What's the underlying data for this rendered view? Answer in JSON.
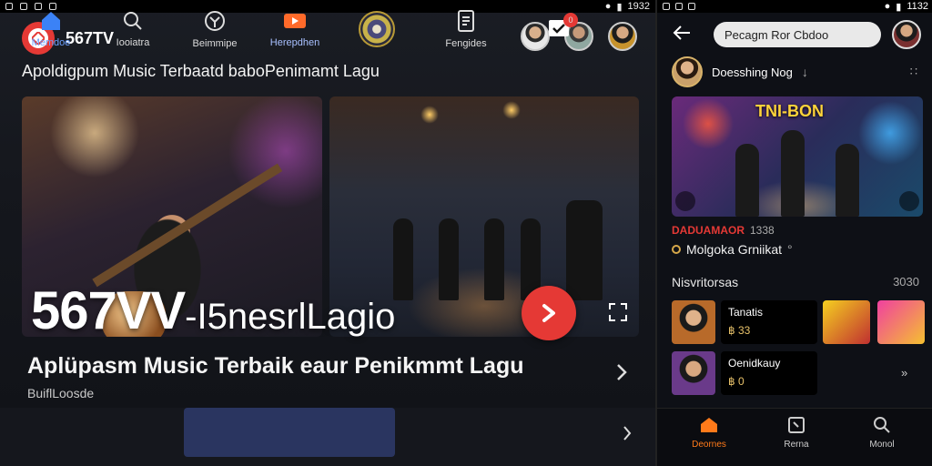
{
  "status_left": {
    "time": "1932"
  },
  "status_right": {
    "time": "1132"
  },
  "app": {
    "name": "567TV"
  },
  "left": {
    "subtitle": "Apoldigpum Music Terbaatd baboPenimamt Lagu",
    "overlay_title": "567VV",
    "overlay_suffix": "-I5nesrlLagio",
    "song_title": "Aplüpasm Music Terbaik eaur Penikmmt Lagu",
    "song_artist": "BuiflLoosde",
    "nav": [
      {
        "label": "Memdoe",
        "icon": "home-icon"
      },
      {
        "label": "Iooiatra",
        "icon": "search-icon"
      },
      {
        "label": "Beimmipe",
        "icon": "discover-icon"
      },
      {
        "label": "Herepdhen",
        "icon": "video-icon"
      },
      {
        "label": "",
        "icon": "disc-icon"
      },
      {
        "label": "Fengides",
        "icon": "document-icon"
      },
      {
        "label": "",
        "icon": "inbox-icon",
        "badge": "0"
      }
    ]
  },
  "right": {
    "search_value": "Pecagm Ror Cbdoo",
    "profile_name": "Doesshing Nog",
    "feature_title": "TNI-BON",
    "meta_tag": "DADUAMAOR",
    "meta_num": "1338",
    "meta_name": "Molgoka Grniikat",
    "meta_suffix": "°",
    "section_title": "Nisvritorsas",
    "section_count": "3030",
    "recs": [
      {
        "title": "Tanatis",
        "sub": "฿ 33"
      },
      {
        "title": "Oenidkauy",
        "sub": "฿ 0"
      }
    ],
    "nav": [
      {
        "label": "Deornes",
        "icon": "home-icon",
        "active": true
      },
      {
        "label": "Rerna",
        "icon": "clock-icon"
      },
      {
        "label": "Monol",
        "icon": "search-icon"
      }
    ]
  },
  "colors": {
    "accent": "#e53935",
    "active_nav": "#ff7a1a",
    "nav_highlight": "#2a3560"
  }
}
